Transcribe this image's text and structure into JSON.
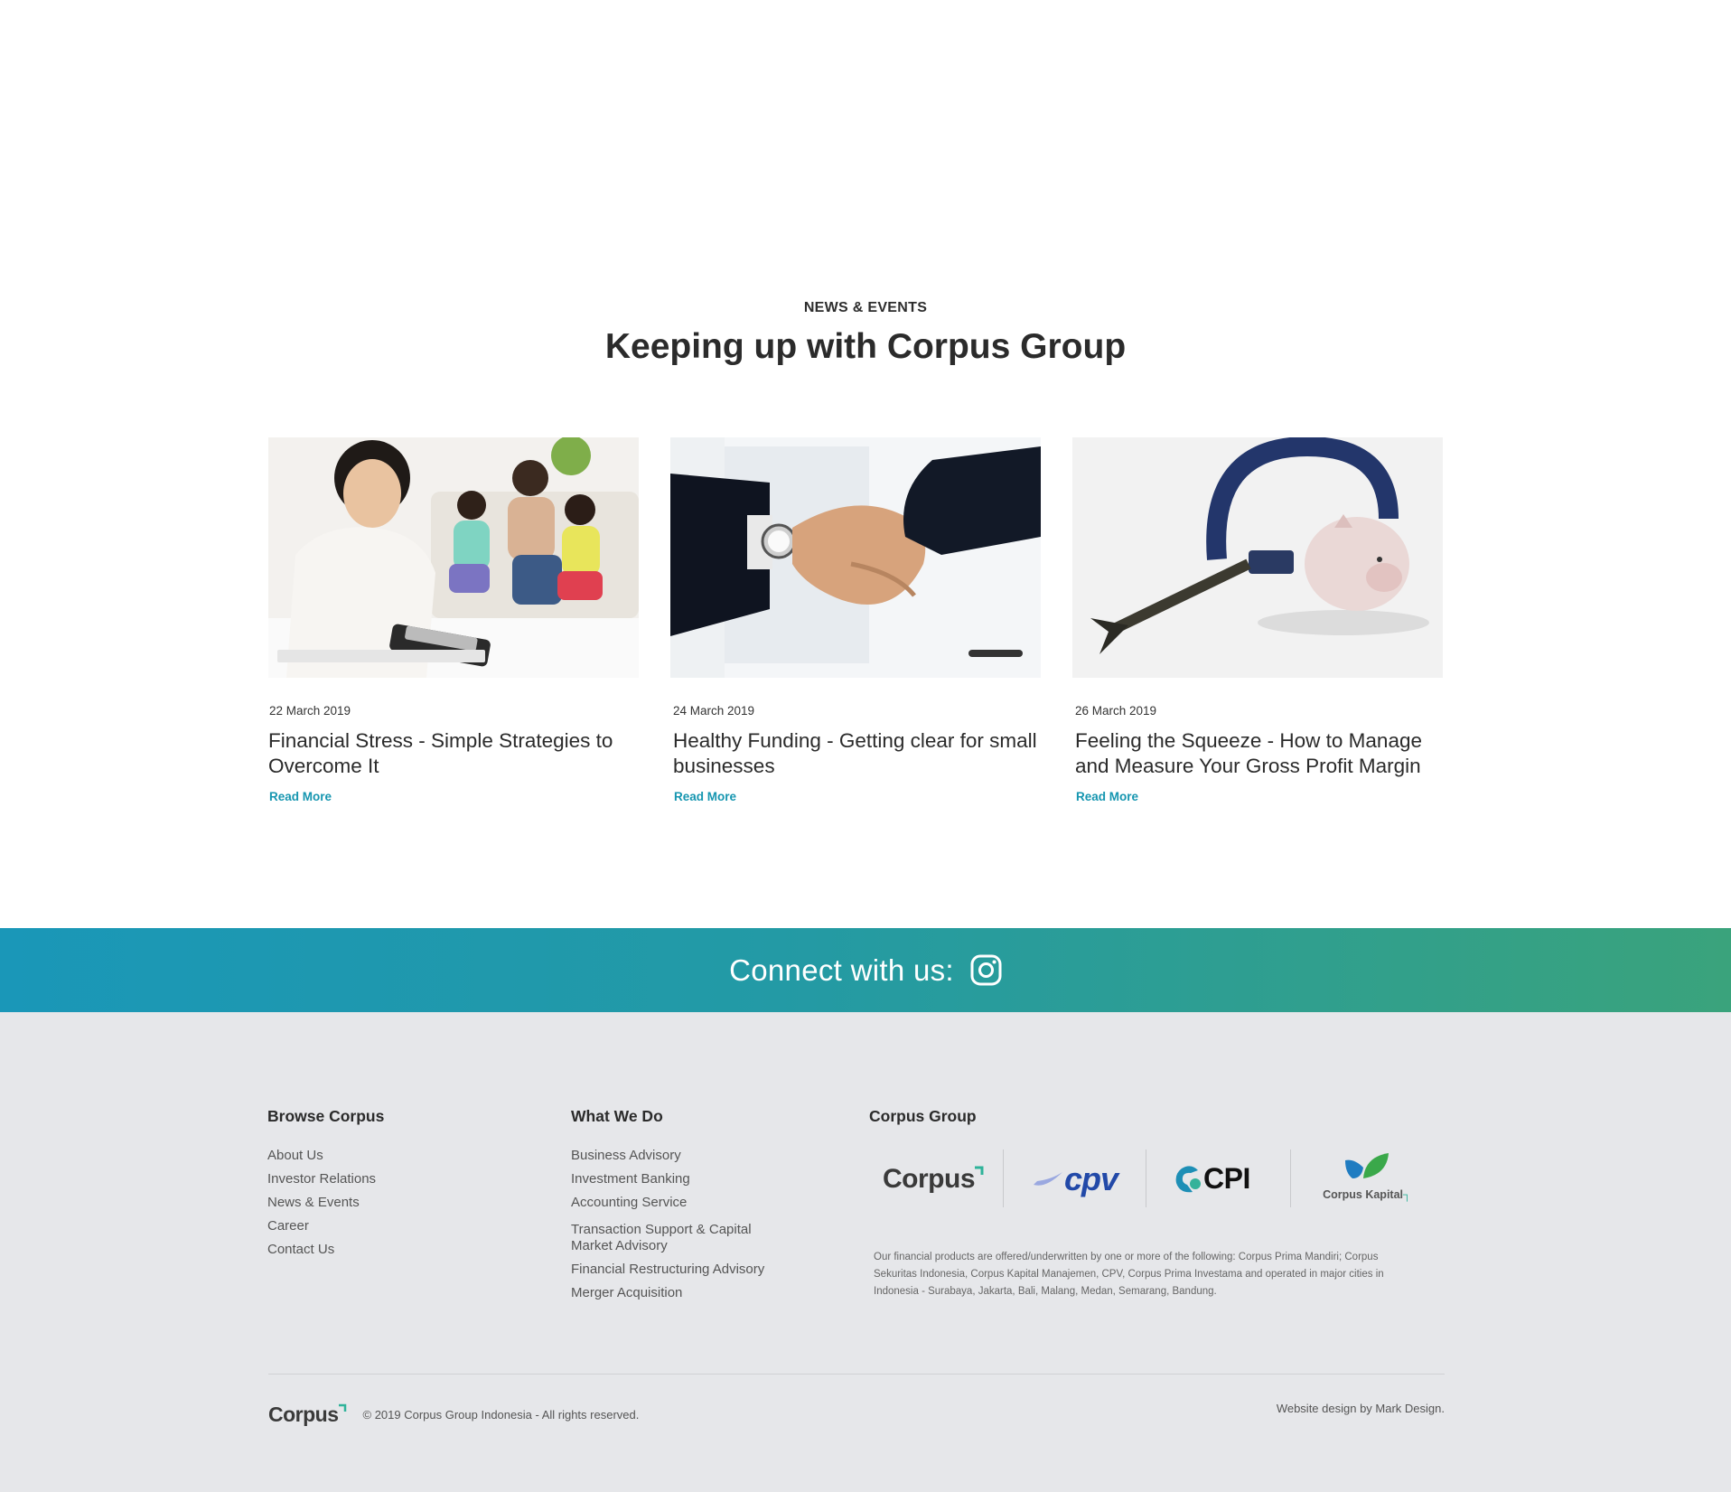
{
  "news": {
    "kicker": "NEWS & EVENTS",
    "heading": "Keeping up with Corpus Group",
    "cards": [
      {
        "date": "22 March 2019",
        "title": "Financial Stress - Simple Strategies to Overcome It",
        "read_more": "Read More"
      },
      {
        "date": "24 March 2019",
        "title": "Healthy Funding - Getting clear for small businesses",
        "read_more": "Read More"
      },
      {
        "date": "26 March 2019",
        "title": "Feeling the Squeeze - How to Manage and Measure Your Gross Profit Margin",
        "read_more": "Read More"
      }
    ]
  },
  "connect": {
    "label": "Connect with us:",
    "icon": "instagram-icon"
  },
  "footer": {
    "browse": {
      "heading": "Browse Corpus",
      "items": [
        "About Us",
        "Investor Relations",
        "News & Events",
        "Career",
        "Contact Us"
      ]
    },
    "what_we_do": {
      "heading": "What We Do",
      "items": [
        "Business Advisory",
        "Investment Banking",
        "Accounting Service",
        "Transaction Support & Capital Market Advisory",
        "Financial Restructuring Advisory",
        "Merger Acquisition"
      ]
    },
    "group": {
      "heading": "Corpus Group",
      "logos": {
        "corpus": "Corpus",
        "cpv": "cpv",
        "cpi": "CPI",
        "kapital": "Corpus Kapital"
      },
      "disclaimer": "Our financial products are offered/underwritten by one or more of the following: Corpus Prima Mandiri; Corpus Sekuritas Indonesia, Corpus Kapital Manajemen, CPV, Corpus Prima Investama and operated in major cities in Indonesia - Surabaya, Jakarta, Bali, Malang, Medan, Semarang, Bandung."
    },
    "bottom": {
      "logo": "Corpus",
      "copyright": "© 2019 Corpus Group Indonesia - All rights reserved.",
      "credit": "Website design by Mark Design."
    }
  },
  "colors": {
    "accent": "#1696b0",
    "gradient_start": "#1a97b8",
    "gradient_end": "#3aa37c",
    "footer_bg": "#e6e7ea"
  }
}
